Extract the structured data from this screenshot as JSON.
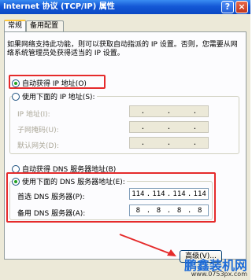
{
  "window": {
    "title": "Internet 协议 (TCP/IP) 属性",
    "help": "?",
    "close": "×"
  },
  "tabs": [
    "常规",
    "备用配置"
  ],
  "description": "如果网络支持此功能，则可以获取自动指派的 IP 设置。否则，您需要从网络系统管理员处获得适当的 IP 设置。",
  "ip": {
    "auto_label": "自动获得 IP 地址(O)",
    "manual_label": "使用下面的 IP 地址(S):",
    "address_label": "IP 地址(I):",
    "mask_label": "子网掩码(U):",
    "gateway_label": "默认网关(D):"
  },
  "dns": {
    "auto_label": "自动获得 DNS 服务器地址(B)",
    "manual_label": "使用下面的 DNS 服务器地址(E):",
    "preferred_label": "首选 DNS 服务器(P):",
    "alternate_label": "备用 DNS 服务器(A):",
    "preferred": [
      "114",
      "114",
      "114",
      "114"
    ],
    "alternate": [
      "8",
      "8",
      "8",
      "8"
    ]
  },
  "buttons": {
    "advanced": "高级(V)..."
  },
  "watermark": {
    "title": "鹏鑫装机网",
    "url": "www.0753px.com"
  },
  "colors": {
    "highlight": "#e52b2b",
    "titlebar": "#0a48c4"
  }
}
